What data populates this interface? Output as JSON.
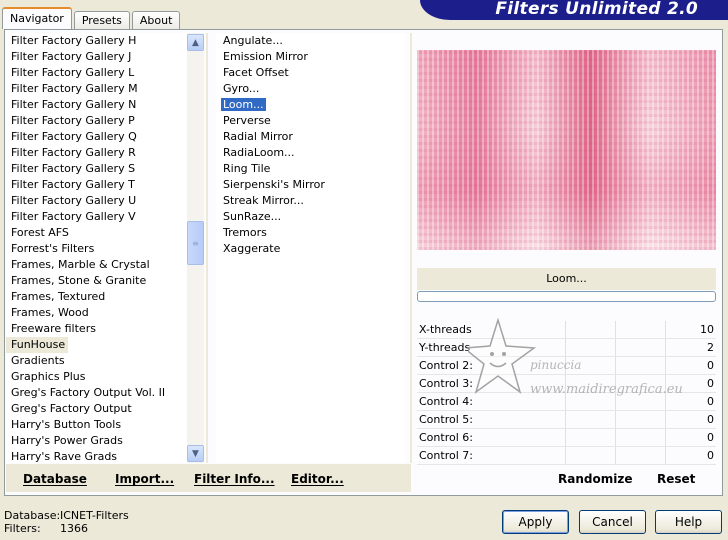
{
  "window": {
    "title": "Filters Unlimited 2.0"
  },
  "tabs": [
    {
      "label": "Navigator",
      "active": true
    },
    {
      "label": "Presets",
      "active": false
    },
    {
      "label": "About",
      "active": false
    }
  ],
  "categories": [
    "Filter Factory Gallery H",
    "Filter Factory Gallery J",
    "Filter Factory Gallery L",
    "Filter Factory Gallery M",
    "Filter Factory Gallery N",
    "Filter Factory Gallery P",
    "Filter Factory Gallery Q",
    "Filter Factory Gallery R",
    "Filter Factory Gallery S",
    "Filter Factory Gallery T",
    "Filter Factory Gallery U",
    "Filter Factory Gallery V",
    "Forest AFS",
    "Forrest's Filters",
    "Frames, Marble & Crystal",
    "Frames, Stone & Granite",
    "Frames, Textured",
    "Frames, Wood",
    "Freeware filters",
    "FunHouse",
    "Gradients",
    "Graphics Plus",
    "Greg's Factory Output Vol. II",
    "Greg's Factory Output",
    "Harry's Button Tools",
    "Harry's Power Grads",
    "Harry's Rave Grads"
  ],
  "selected_category": "FunHouse",
  "filters": [
    "Angulate...",
    "Emission Mirror",
    "Facet Offset",
    "Gyro...",
    "Loom...",
    "Perverse",
    "Radial Mirror",
    "RadiaLoom...",
    "Ring Tile",
    "Sierpenski's Mirror",
    "Streak Mirror...",
    "SunRaze...",
    "Tremors",
    "Xaggerate"
  ],
  "selected_filter": "Loom...",
  "bottom_links": {
    "database": "Database",
    "import": "Import...",
    "filter_info": "Filter Info...",
    "editor": "Editor..."
  },
  "preview": {
    "filter_name": "Loom...",
    "progress": 0
  },
  "params": [
    {
      "label": "X-threads",
      "value": "10"
    },
    {
      "label": "Y-threads",
      "value": "2"
    },
    {
      "label": "Control 2:",
      "value": "0"
    },
    {
      "label": "Control 3:",
      "value": "0"
    },
    {
      "label": "Control 4:",
      "value": "0"
    },
    {
      "label": "Control 5:",
      "value": "0"
    },
    {
      "label": "Control 6:",
      "value": "0"
    },
    {
      "label": "Control 7:",
      "value": "0"
    }
  ],
  "right_buttons": {
    "randomize": "Randomize",
    "reset": "Reset"
  },
  "watermark": {
    "line1": "pinuccia",
    "line2": "www.maidiregrafica.eu"
  },
  "status": {
    "database_label": "Database:",
    "database_value": "ICNET-Filters",
    "filters_label": "Filters:",
    "filters_value": "1366"
  },
  "buttons": {
    "apply": "Apply",
    "cancel": "Cancel",
    "help": "Help"
  },
  "colors": {
    "selection": "#316ac5",
    "title_banner": "#1c1e8c",
    "tab_accent": "#e68b2c"
  }
}
